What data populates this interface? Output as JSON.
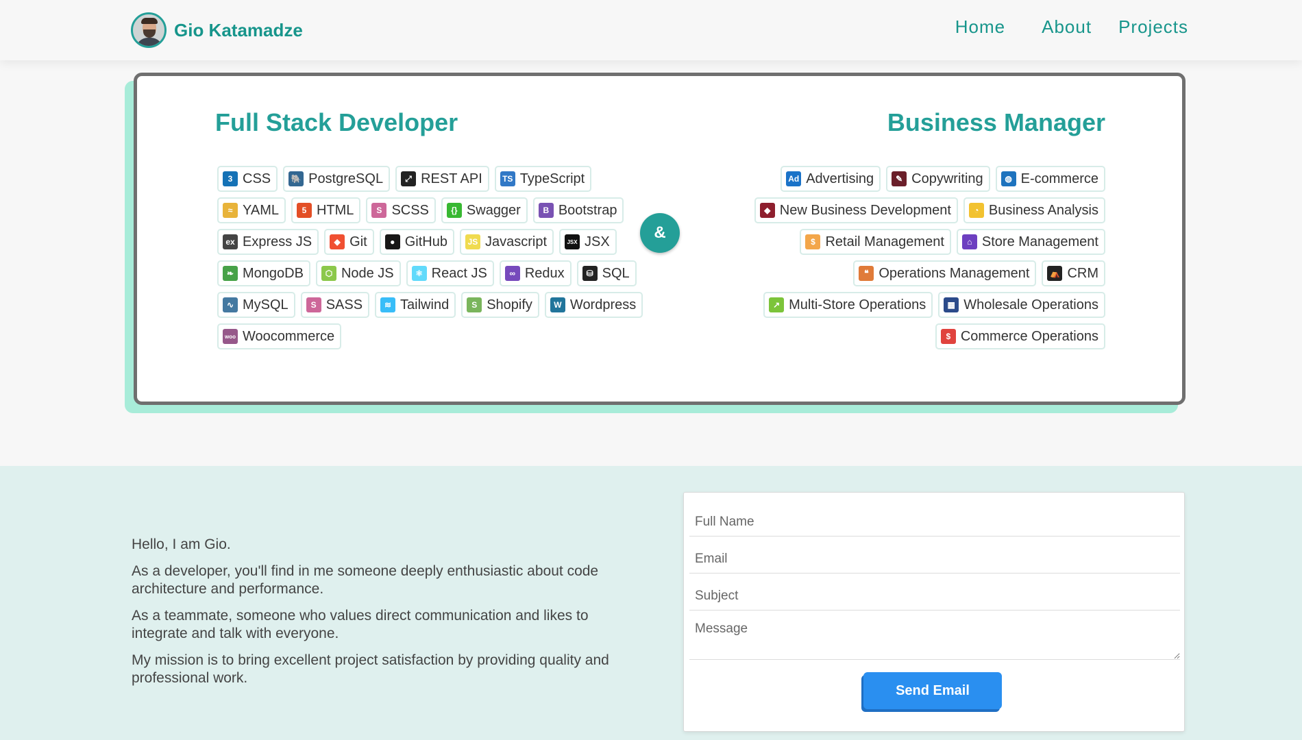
{
  "header": {
    "name": "Gio Katamadze",
    "nav": {
      "home": "Home",
      "about": "About",
      "projects": "Projects"
    }
  },
  "skills": {
    "left_title": "Full Stack Developer",
    "right_title": "Business Manager",
    "ampersand": "&",
    "developer_rows": [
      [
        {
          "label": "CSS",
          "icon": "css3-icon",
          "color": "#1572b6",
          "glyph": "3"
        },
        {
          "label": "PostgreSQL",
          "icon": "postgresql-icon",
          "color": "#336791",
          "glyph": "🐘"
        },
        {
          "label": "REST API",
          "icon": "api-icon",
          "color": "#222222",
          "glyph": "⤢"
        },
        {
          "label": "TypeScript",
          "icon": "typescript-icon",
          "color": "#3178c6",
          "glyph": "TS"
        }
      ],
      [
        {
          "label": "YAML",
          "icon": "yaml-icon",
          "color": "#e8b33a",
          "glyph": "≈"
        },
        {
          "label": "HTML",
          "icon": "html5-icon",
          "color": "#e34f26",
          "glyph": "5"
        },
        {
          "label": "SCSS",
          "icon": "scss-icon",
          "color": "#cd6799",
          "glyph": "S"
        },
        {
          "label": "Swagger",
          "icon": "swagger-icon",
          "color": "#38b832",
          "glyph": "{}"
        },
        {
          "label": "Bootstrap",
          "icon": "bootstrap-icon",
          "color": "#7952b3",
          "glyph": "B"
        }
      ],
      [
        {
          "label": "Express JS",
          "icon": "express-icon",
          "color": "#444444",
          "glyph": "ex"
        },
        {
          "label": "Git",
          "icon": "git-icon",
          "color": "#f05032",
          "glyph": "◆"
        },
        {
          "label": "GitHub",
          "icon": "github-icon",
          "color": "#181717",
          "glyph": "●"
        },
        {
          "label": "Javascript",
          "icon": "javascript-icon",
          "color": "#f0db4f",
          "glyph": "JS"
        },
        {
          "label": "JSX",
          "icon": "jsx-icon",
          "color": "#111111",
          "glyph": "JSX"
        }
      ],
      [
        {
          "label": "MongoDB",
          "icon": "mongodb-icon",
          "color": "#47a248",
          "glyph": "❧"
        },
        {
          "label": "Node JS",
          "icon": "nodejs-icon",
          "color": "#8cc84b",
          "glyph": "⬡"
        },
        {
          "label": "React JS",
          "icon": "react-icon",
          "color": "#61dafb",
          "glyph": "⚛"
        },
        {
          "label": "Redux",
          "icon": "redux-icon",
          "color": "#764abc",
          "glyph": "∞"
        },
        {
          "label": "SQL",
          "icon": "sql-icon",
          "color": "#222222",
          "glyph": "⛁"
        }
      ],
      [
        {
          "label": "MySQL",
          "icon": "mysql-icon",
          "color": "#4479a1",
          "glyph": "∿"
        },
        {
          "label": "SASS",
          "icon": "sass-icon",
          "color": "#cd6799",
          "glyph": "S"
        },
        {
          "label": "Tailwind",
          "icon": "tailwind-icon",
          "color": "#38bdf8",
          "glyph": "≋"
        },
        {
          "label": "Shopify",
          "icon": "shopify-icon",
          "color": "#7ab55c",
          "glyph": "S"
        },
        {
          "label": "Wordpress",
          "icon": "wordpress-icon",
          "color": "#21759b",
          "glyph": "W"
        }
      ],
      [
        {
          "label": "Woocommerce",
          "icon": "woocommerce-icon",
          "color": "#96588a",
          "glyph": "woo"
        }
      ]
    ],
    "business_rows": [
      [
        {
          "label": "Advertising",
          "icon": "ad-icon",
          "color": "#1a73c8",
          "glyph": "Ad"
        },
        {
          "label": "Copywriting",
          "icon": "file-pen-icon",
          "color": "#6b1f2a",
          "glyph": "✎"
        },
        {
          "label": "E-commerce",
          "icon": "globe-icon",
          "color": "#1e73be",
          "glyph": "◍"
        }
      ],
      [
        {
          "label": "New Business Development",
          "icon": "tag-icon",
          "color": "#8e1f2e",
          "glyph": "◆"
        },
        {
          "label": "Business Analysis",
          "icon": "pie-chart-icon",
          "color": "#f2c230",
          "glyph": "◔"
        }
      ],
      [
        {
          "label": "Retail Management",
          "icon": "receipt-icon",
          "color": "#f3a64a",
          "glyph": "$"
        },
        {
          "label": "Store Management",
          "icon": "store-icon",
          "color": "#6d3fc0",
          "glyph": "⌂"
        }
      ],
      [
        {
          "label": "Operations Management",
          "icon": "comments-icon",
          "color": "#e07b39",
          "glyph": "❝"
        },
        {
          "label": "CRM",
          "icon": "handshake-icon",
          "color": "#222222",
          "glyph": "⛺"
        }
      ],
      [
        {
          "label": "Multi-Store Operations",
          "icon": "growth-chart-icon",
          "color": "#7cc43a",
          "glyph": "↗"
        },
        {
          "label": "Wholesale Operations",
          "icon": "warehouse-icon",
          "color": "#2b4a8a",
          "glyph": "▦"
        }
      ],
      [
        {
          "label": "Commerce Operations",
          "icon": "invoice-icon",
          "color": "#e0433e",
          "glyph": "$"
        }
      ]
    ]
  },
  "about": {
    "paragraphs": [
      "Hello, I am Gio.",
      "As a developer, you'll find in me someone deeply enthusiastic about code architecture and performance.",
      "As a teammate, someone who values direct communication and likes to integrate and talk with everyone.",
      "My mission is to bring excellent project satisfaction by providing quality and professional work."
    ]
  },
  "contact_form": {
    "full_name_placeholder": "Full Name",
    "email_placeholder": "Email",
    "subject_placeholder": "Subject",
    "message_placeholder": "Message",
    "send_label": "Send Email"
  }
}
